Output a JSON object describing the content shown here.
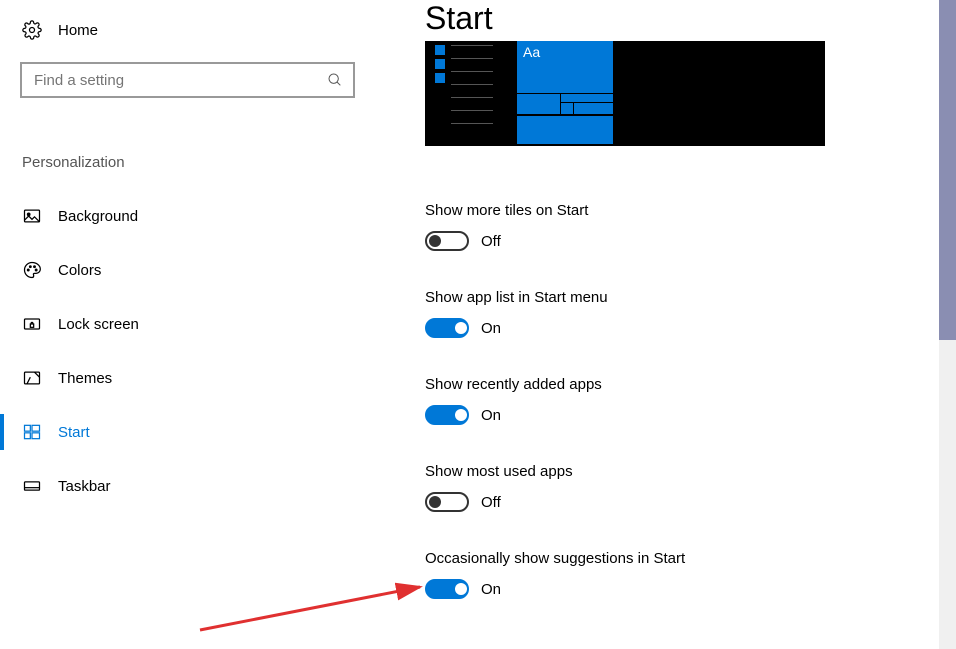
{
  "home_label": "Home",
  "search_placeholder": "Find a setting",
  "section": "Personalization",
  "nav": [
    {
      "id": "background",
      "label": "Background"
    },
    {
      "id": "colors",
      "label": "Colors"
    },
    {
      "id": "lockscreen",
      "label": "Lock screen"
    },
    {
      "id": "themes",
      "label": "Themes"
    },
    {
      "id": "start",
      "label": "Start"
    },
    {
      "id": "taskbar",
      "label": "Taskbar"
    }
  ],
  "page_title": "Start",
  "preview_aa": "Aa",
  "settings": [
    {
      "label": "Show more tiles on Start",
      "state": "Off",
      "on": false
    },
    {
      "label": "Show app list in Start menu",
      "state": "On",
      "on": true
    },
    {
      "label": "Show recently added apps",
      "state": "On",
      "on": true
    },
    {
      "label": "Show most used apps",
      "state": "Off",
      "on": false
    },
    {
      "label": "Occasionally show suggestions in Start",
      "state": "On",
      "on": true
    }
  ]
}
